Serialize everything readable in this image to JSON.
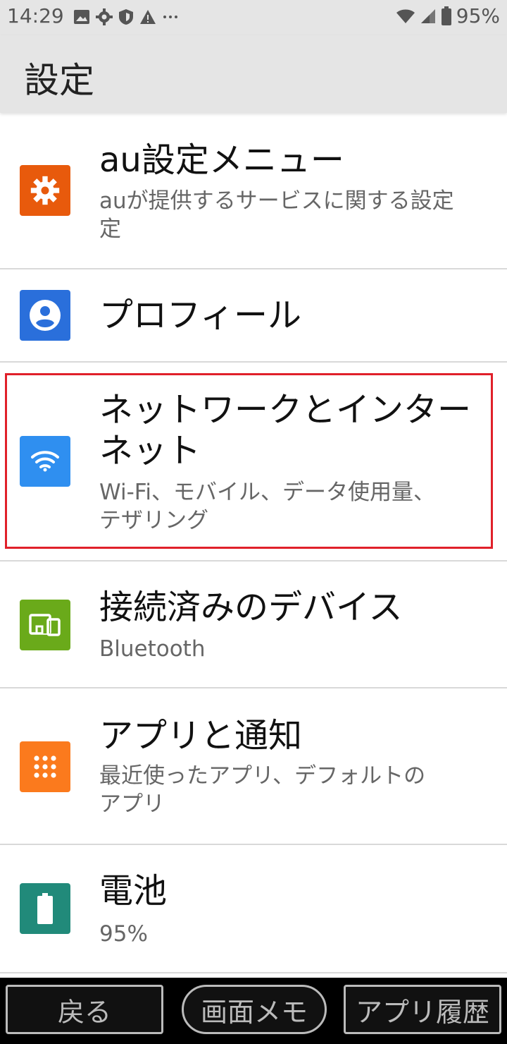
{
  "status": {
    "time": "14:29",
    "battery_text": "95%",
    "left_icons": [
      "image-icon",
      "gear-icon",
      "shield-icon",
      "warning-icon",
      "more-icon"
    ],
    "right_icons": [
      "wifi-icon",
      "signal-icon",
      "battery-icon"
    ]
  },
  "header": {
    "title": "設定"
  },
  "items": [
    {
      "title": "au設定メニュー",
      "subtitle": "auが提供するサービスに関する設定",
      "subtitle_line2": "定",
      "icon": "gear-icon",
      "color": "#e85a0c"
    },
    {
      "title": "プロフィール",
      "subtitle": "",
      "icon": "person-icon",
      "color": "#2a6fdb"
    },
    {
      "title": "ネットワークとインター",
      "title_line2": "ネット",
      "subtitle": "Wi-Fi、モバイル、データ使用量、",
      "subtitle_line2": "テザリング",
      "icon": "wifi-icon",
      "color": "#2f8ff0"
    },
    {
      "title": "接続済みのデバイス",
      "subtitle": "Bluetooth",
      "icon": "devices-icon",
      "color": "#6aaa1a"
    },
    {
      "title": "アプリと通知",
      "subtitle": "最近使ったアプリ、デフォルトの",
      "subtitle_line2": "アプリ",
      "icon": "apps-icon",
      "color": "#fb7a1d"
    },
    {
      "title": "電池",
      "subtitle": "95%",
      "icon": "battery-icon",
      "color": "#218a7a"
    }
  ],
  "highlight_color": "#e0202a",
  "nav": {
    "back": "戻る",
    "memo": "画面メモ",
    "history": "アプリ履歴"
  }
}
